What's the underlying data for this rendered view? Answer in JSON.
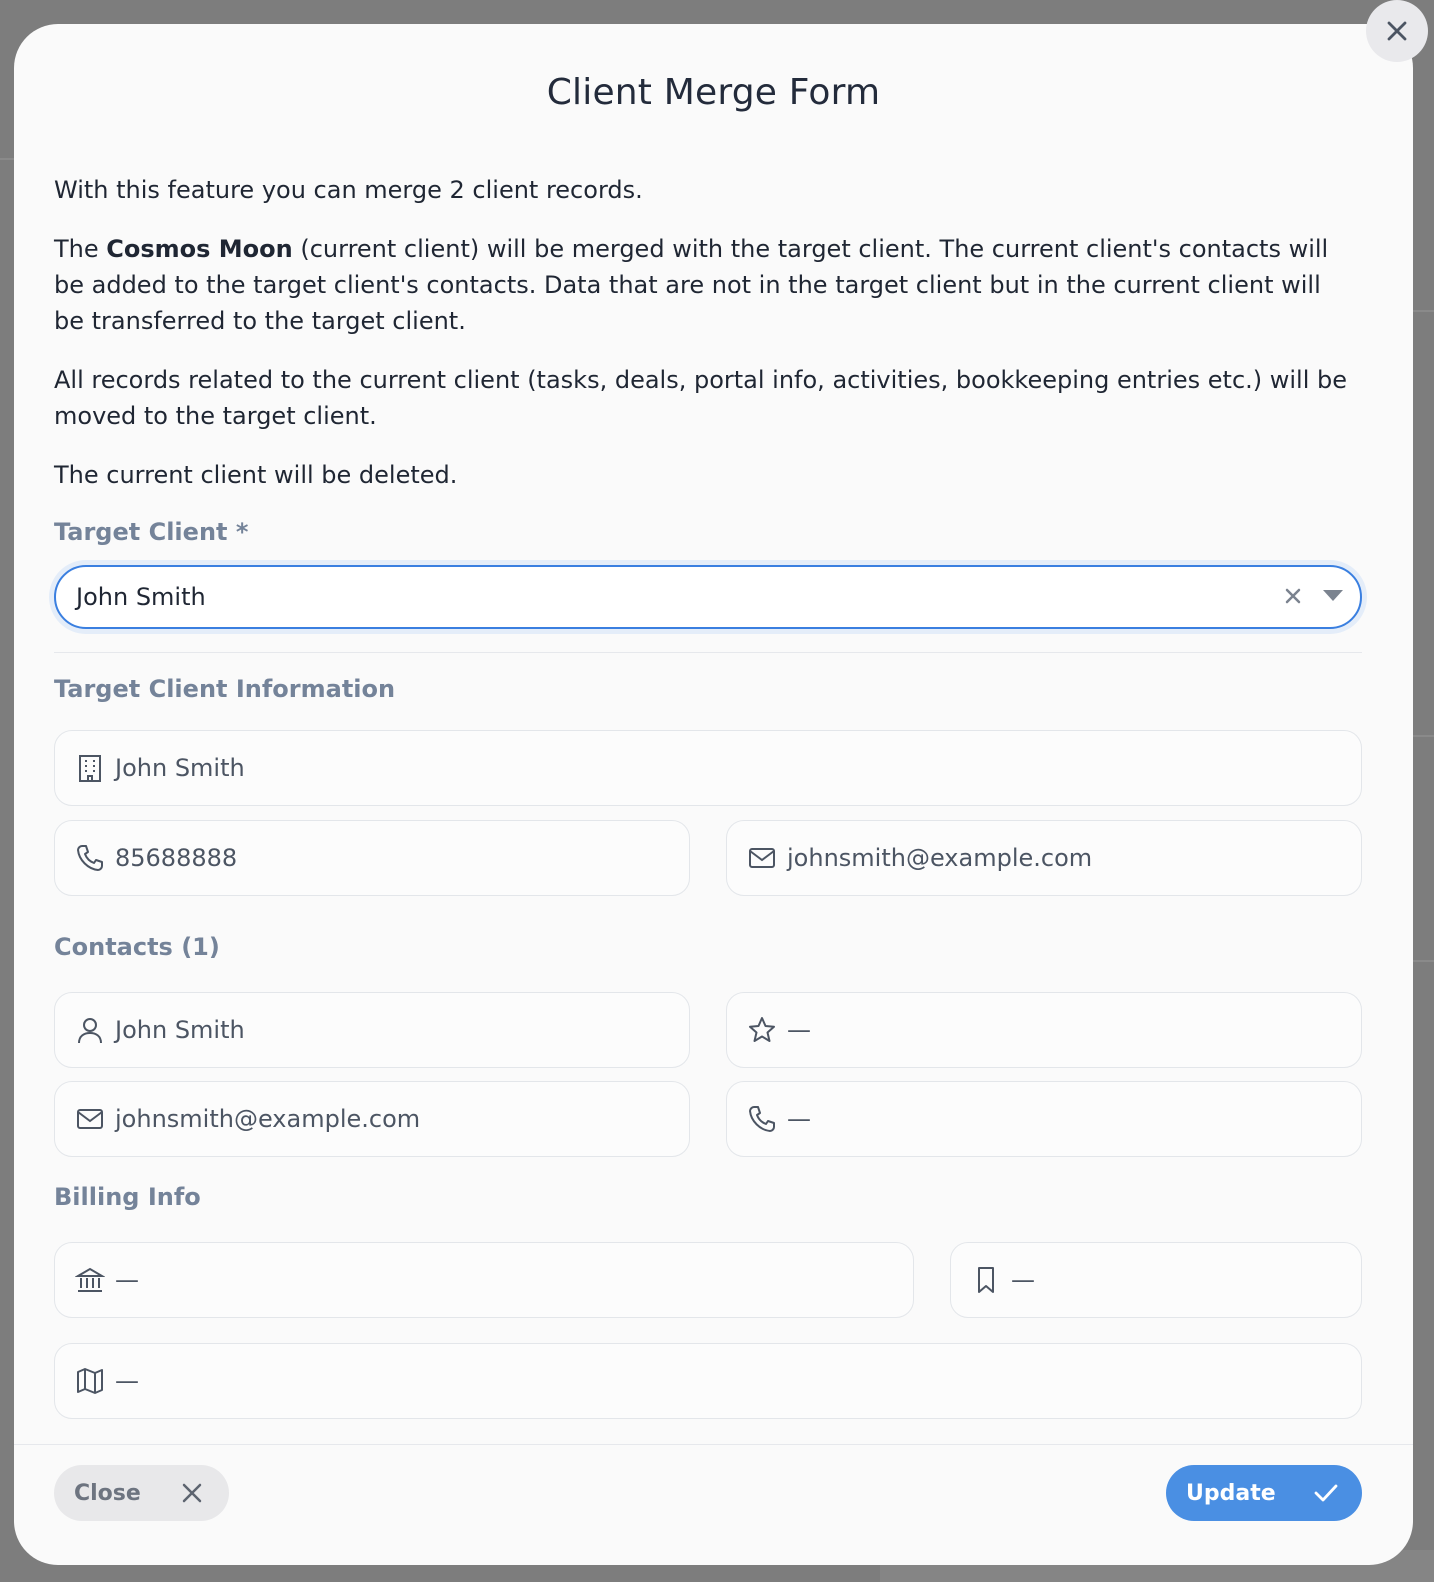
{
  "modal": {
    "title": "Client Merge Form",
    "intro": "With this feature you can merge 2 client records.",
    "merge_prefix": "The ",
    "current_client_name": "Cosmos Moon",
    "merge_suffix": " (current client) will be merged with the target client. The current client's contacts will be added to the target client's contacts. Data that are not in the target client but in the current client will be transferred to the target client.",
    "records_text": "All records related to the current client (tasks, deals, portal info, activities, bookkeeping entries etc.) will be moved to the target client.",
    "deleted_text": "The current client will be deleted."
  },
  "target_client": {
    "label": "Target Client *",
    "selected_value": "John Smith"
  },
  "target_info": {
    "heading": "Target Client Information",
    "company": "John Smith",
    "phone": "85688888",
    "email": "johnsmith@example.com"
  },
  "contacts": {
    "heading": "Contacts (1)",
    "name": "John Smith",
    "role": "—",
    "email": "johnsmith@example.com",
    "phone": "—"
  },
  "billing": {
    "heading": "Billing Info",
    "bank": "—",
    "tax_id": "—",
    "address": "—"
  },
  "footer": {
    "close_label": "Close",
    "update_label": "Update"
  },
  "colors": {
    "accent": "#4a8fe3",
    "select_border": "#3a7fe0",
    "section_heading": "#748399"
  }
}
